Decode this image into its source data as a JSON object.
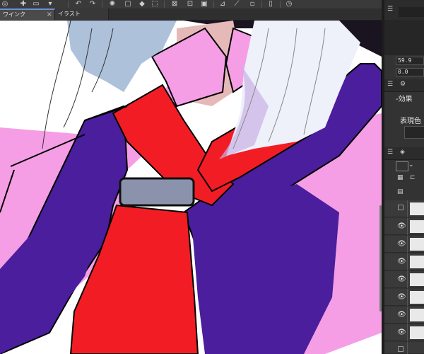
{
  "window": {
    "tabs": [
      {
        "label": "ワインク",
        "state": "active"
      },
      {
        "label": "イラスト",
        "state": "inactive"
      }
    ],
    "tab_close_glyph": "×"
  },
  "toolbar": {
    "icons": [
      "app-icon",
      "new-file-icon",
      "open-file-icon",
      "save-icon",
      "undo-icon",
      "redo-icon",
      "loading-icon",
      "clear-icon",
      "fill-icon",
      "transform-icon",
      "hide-selection-icon",
      "crop-icon",
      "snap-icon",
      "ruler-icon",
      "pen-icon",
      "document-icon",
      "pressure-icon"
    ]
  },
  "panel": {
    "brush_size_value": "59.9",
    "opacity_value": "0.0",
    "effect_label": "-効果",
    "expression_color_label": "表現色"
  },
  "layers": {
    "rows": [
      {
        "visible": false
      },
      {
        "visible": true
      },
      {
        "visible": true
      },
      {
        "visible": true
      },
      {
        "visible": true
      },
      {
        "visible": true
      },
      {
        "visible": true
      },
      {
        "visible": true
      },
      {
        "visible": false
      }
    ]
  },
  "colors": {
    "coat_purple": "#4a1e9c",
    "shirt_pink": "#f59ee5",
    "tie_red": "#f21d24",
    "ring_gray": "#8a93ab",
    "hair_blue": "#9fb6d3",
    "ui_dark": "#2b2b2b"
  }
}
